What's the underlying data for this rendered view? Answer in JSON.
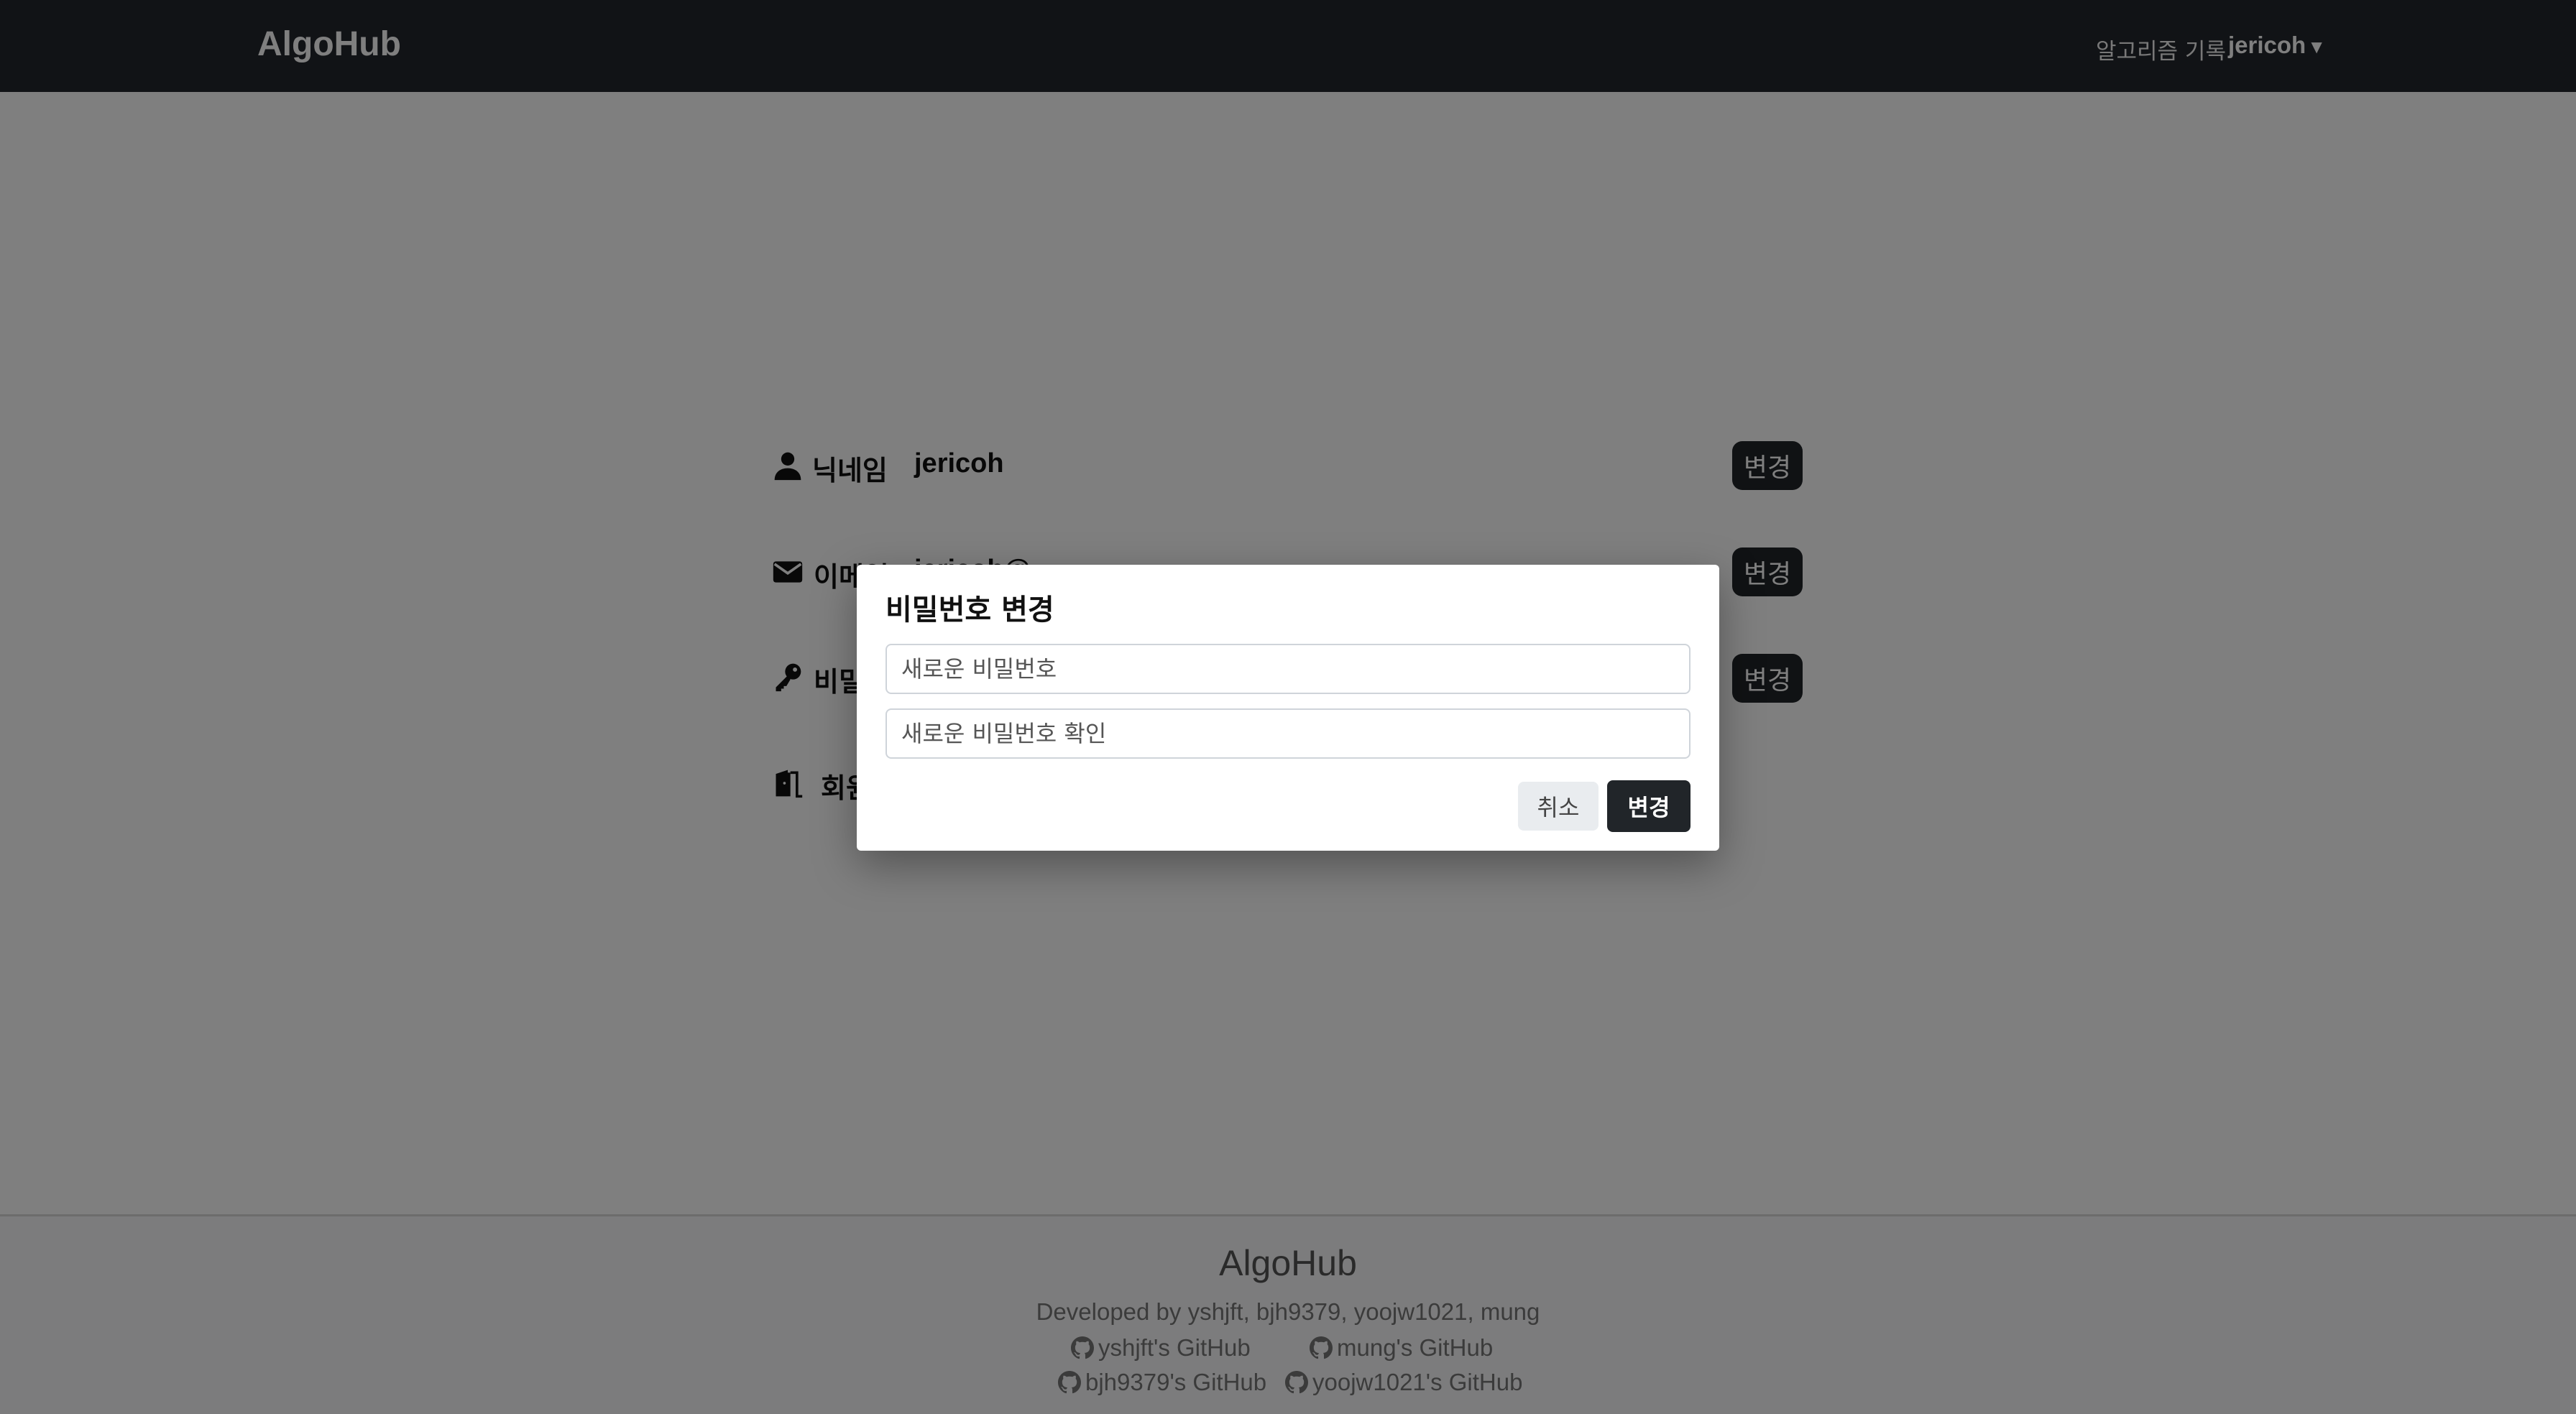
{
  "header": {
    "logo": "AlgoHub",
    "nav_link": "알고리즘 기록",
    "user": "jericoh",
    "user_caret": "▼"
  },
  "settings": {
    "nickname": {
      "label": "닉네임",
      "value": "jericoh",
      "button": "변경",
      "icon": "user-icon"
    },
    "email": {
      "label": "이메일",
      "value": "jericoh@",
      "button": "변경",
      "icon": "envelope-icon"
    },
    "password": {
      "label": "비밀번호",
      "button": "변경",
      "icon": "key-icon"
    },
    "withdraw": {
      "label": "회원탈퇴",
      "icon": "door-exit-icon"
    }
  },
  "modal": {
    "title": "비밀번호 변경",
    "new_password_placeholder": "새로운 비밀번호",
    "confirm_password_placeholder": "새로운 비밀번호 확인",
    "cancel_label": "취소",
    "confirm_label": "변경"
  },
  "footer": {
    "title": "AlgoHub",
    "credit": "Developed by yshjft, bjh9379, yoojw1021, mung",
    "links": [
      "yshjft's GitHub",
      "mung's GitHub",
      "bjh9379's GitHub",
      "yoojw1021's GitHub"
    ]
  },
  "colors": {
    "header_bg": "#23262c",
    "button_dark": "#212529",
    "overlay": "rgba(0,0,0,0.5)"
  }
}
